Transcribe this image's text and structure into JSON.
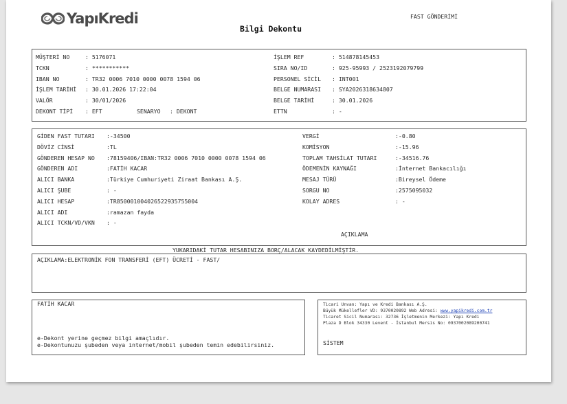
{
  "header": {
    "logo_text": "YapıKredi",
    "title": "Bilgi Dekontu",
    "doc_type": "FAST GÖNDERİMİ"
  },
  "info_box": {
    "left": [
      {
        "label": "MÜŞTERİ NO",
        "value": ": 5176071"
      },
      {
        "label": "TCKN",
        "value": ": ***********"
      },
      {
        "label": "IBAN NO",
        "value": ": TR32 0006 7010 0000 0078 1594 06"
      },
      {
        "label": "İŞLEM TARİHİ",
        "value": ": 30.01.2026 17:22:04"
      },
      {
        "label": "VALÖR",
        "value": ": 30/01/2026"
      },
      {
        "label": "DEKONT TİPİ",
        "value": ": EFT"
      }
    ],
    "senaryo_label": "SENARYO",
    "senaryo_value": ": DEKONT",
    "right": [
      {
        "label": "İŞLEM REF",
        "value": ": 514878145453"
      },
      {
        "label": "SIRA NO/ID",
        "value": ": 925-95993 / 2523192079799"
      },
      {
        "label": "PERSONEL SİCİL",
        "value": ": INT001"
      },
      {
        "label": "BELGE NUMARASI",
        "value": ": SYA2026318634807"
      },
      {
        "label": "BELGE TARİHİ",
        "value": ": 30.01.2026"
      },
      {
        "label": "ETTN",
        "value": ": -"
      }
    ]
  },
  "transfer_box": {
    "left": [
      {
        "label": "GİDEN FAST TUTARI",
        "value": ":-34500"
      },
      {
        "label": "DÖVİZ CİNSİ",
        "value": ":TL"
      },
      {
        "label": "GÖNDEREN HESAP NO",
        "value": ":78159406/IBAN:TR32 0006 7010 0000 0078 1594 06"
      },
      {
        "label": "GÖNDEREN ADI",
        "value": ":FATİH KACAR"
      },
      {
        "label": "ALICI BANKA",
        "value": ":Türkiye Cumhuriyeti Ziraat Bankası A.Ş."
      },
      {
        "label": "ALICI ŞUBE",
        "value": ": -"
      },
      {
        "label": "ALICI HESAP",
        "value": ":TR850001004026522935755004"
      },
      {
        "label": "ALICI ADI",
        "value": ":ramazan fayda"
      },
      {
        "label": "ALICI TCKN/VD/VKN",
        "value": ": -"
      }
    ],
    "right": [
      {
        "label": "VERGİ",
        "value": ":-0.80"
      },
      {
        "label": "KOMİSYON",
        "value": ":-15.96"
      },
      {
        "label": "TOPLAM TAHSİLAT TUTARI",
        "value": ":-34516.76"
      },
      {
        "label": "ÖDEMENİN KAYNAĞI",
        "value": ":İnternet Bankacılığı"
      },
      {
        "label": "MESAJ TÜRÜ",
        "value": ":Bireysel Ödeme"
      },
      {
        "label": "SORGU NO",
        "value": ":2575095032"
      },
      {
        "label": "KOLAY ADRES",
        "value": ": -"
      }
    ],
    "aciklama_heading": "AÇIKLAMA"
  },
  "notice": "YUKARIDAKİ TUTAR HESABINIZA BORÇ/ALACAK KAYDEDİLMİŞTİR.",
  "description": "AÇIKLAMA:ELEKTRONİK FON TRANSFERİ (EFT) ÜCRETİ - FAST/",
  "footer_left": {
    "name": "FATİH KACAR",
    "line1": "e-Dekont yerine geçmez bilgi amaçlıdır.",
    "line2": "e-Dekontunuzu şubeden veya internet/mobil şubeden temin edebilirsiniz."
  },
  "footer_right": {
    "line1": "Ticari Unvan: Yapı ve Kredi Bankası A.Ş.",
    "line2_prefix": "Büyük Mükellefler VD: 9370020892 Web Adresi: ",
    "line2_link": "www.yapikredi.com.tr",
    "line3": "Ticaret Sicil Numarası: 32736 İşletmenin Merkezi: Yapı Kredi",
    "line4": "Plaza D Blok 34330 Levent - İstanbul Mersis No: 0937002089200741",
    "sistem": "SİSTEM"
  }
}
